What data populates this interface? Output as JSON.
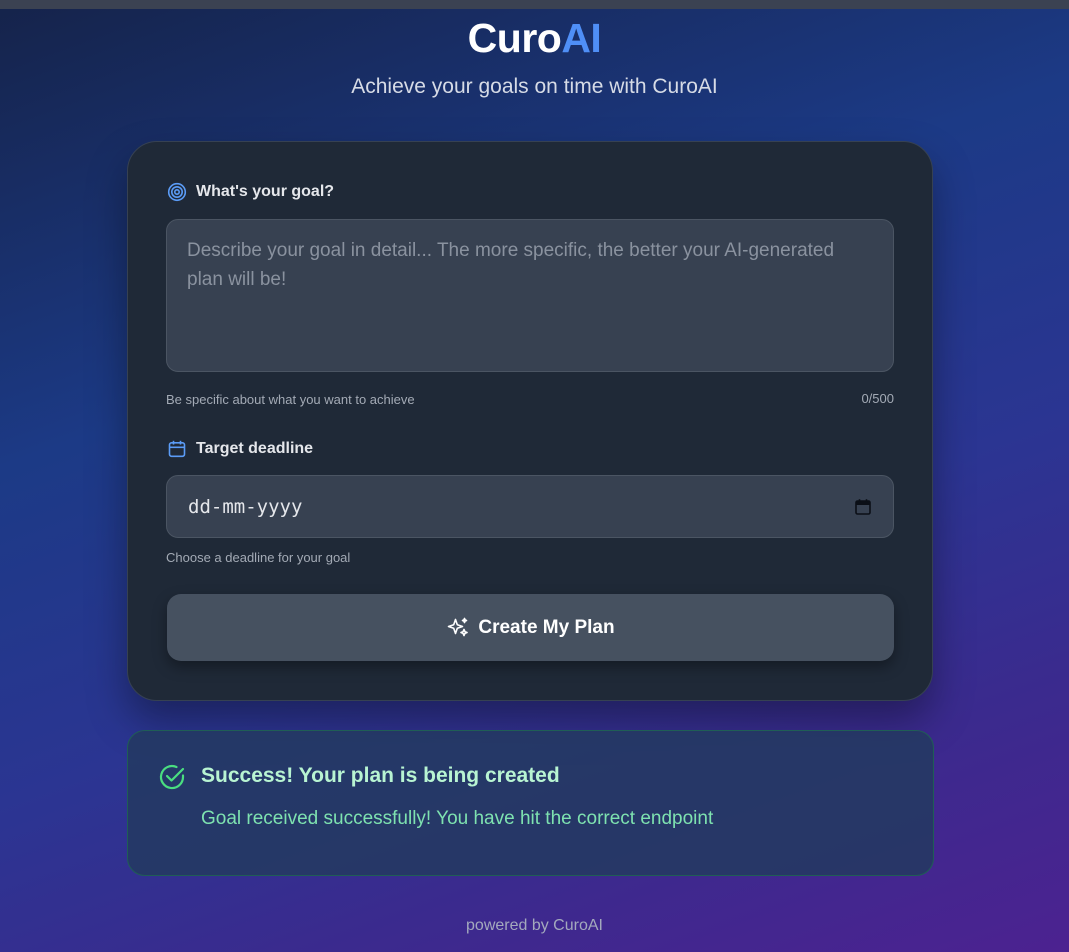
{
  "brand": {
    "part1": "Curo",
    "part2": "AI"
  },
  "tagline": "Achieve your goals on time with CuroAI",
  "form": {
    "goal_label": "What's your goal?",
    "goal_placeholder": "Describe your goal in detail... The more specific, the better your AI-generated plan will be!",
    "goal_value": "",
    "goal_hint": "Be specific about what you want to achieve",
    "char_counter": "0/500",
    "deadline_label": "Target deadline",
    "deadline_placeholder": "dd-mm-yyyy",
    "deadline_hint": "Choose a deadline for your goal",
    "submit_label": "Create My Plan"
  },
  "success": {
    "title": "Success! Your plan is being created",
    "message": "Goal received successfully! You have hit the correct endpoint"
  },
  "footer": "powered by CuroAI",
  "icons": {
    "goal": "target-icon",
    "deadline": "calendar-icon",
    "date_picker": "calendar-icon",
    "submit": "sparkles-icon",
    "success": "check-circle-icon"
  },
  "colors": {
    "accent": "#4f8ff7",
    "success": "#4ade80",
    "card": "#1f2937",
    "input": "#374151",
    "button": "#465160"
  }
}
